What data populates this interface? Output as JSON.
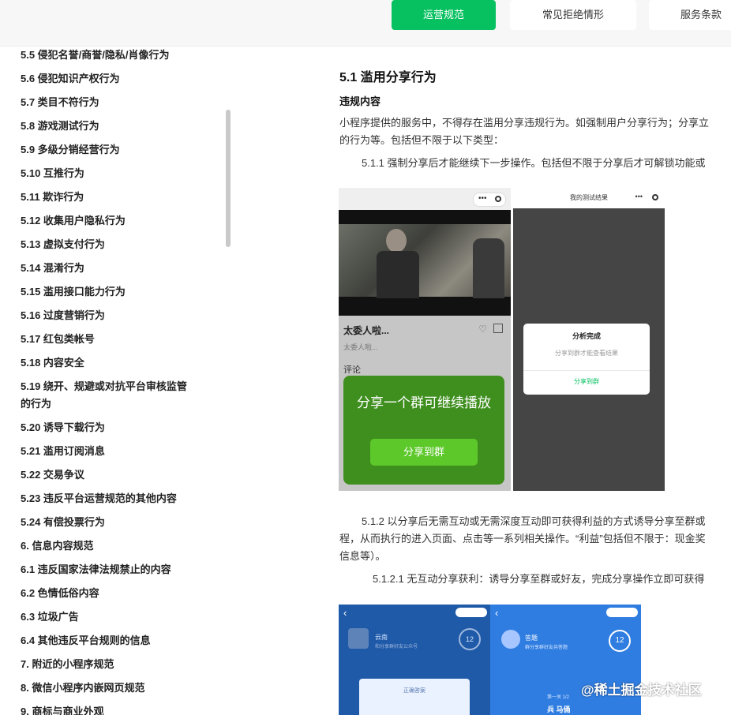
{
  "tabs": [
    {
      "label": "运营规范",
      "active": true
    },
    {
      "label": "常见拒绝情形",
      "active": false
    },
    {
      "label": "服务条款",
      "active": false
    }
  ],
  "sidebar": {
    "items": [
      "5.5 侵犯名誉/商誉/隐私/肖像行为",
      "5.6 侵犯知识产权行为",
      "5.7 类目不符行为",
      "5.8 游戏测试行为",
      "5.9 多级分销经营行为",
      "5.10 互推行为",
      "5.11 欺诈行为",
      "5.12 收集用户隐私行为",
      "5.13 虚拟支付行为",
      "5.14 混淆行为",
      "5.15 滥用接口能力行为",
      "5.16 过度营销行为",
      "5.17 红包类帐号",
      "5.18 内容安全",
      "5.19 绕开、规避或对抗平台审核监管的行为",
      "5.20 诱导下载行为",
      "5.21 滥用订阅消息",
      "5.22 交易争议",
      "5.23 违反平台运营规范的其他内容",
      "5.24 有偿投票行为",
      "6. 信息内容规范",
      "6.1 违反国家法律法规禁止的内容",
      "6.2 色情低俗内容",
      "6.3 垃圾广告",
      "6.4 其他违反平台规则的信息",
      "7. 附近的小程序规范",
      "8. 微信小程序内嵌网页规范",
      "9. 商标与商业外观"
    ]
  },
  "content": {
    "heading": "5.1 滥用分享行为",
    "subheading": "违规内容",
    "para1_line1": "小程序提供的服务中，不得存在滥用分享违规行为。如强制用户分享行为；分享立",
    "para1_line2": "的行为等。包括但不限于以下类型：",
    "para2": "5.1.1 强制分享后才能继续下一步操作。包括但不限于分享后才可解锁功能或",
    "para3_line1": "5.1.2 以分享后无需互动或无需深度互动即可获得利益的方式诱导分享至群或",
    "para3_line2": "程，从而执行的进入页面、点击等一系列相关操作。“利益”包括但不限于：现金奖",
    "para3_line3": "信息等）。",
    "para4": "5.1.2.1 无互动分享获利：诱导分享至群或好友，完成分享操作立即可获得"
  },
  "shot1": {
    "left_title": "太委人啦...",
    "left_sub": "太委人啦...",
    "comment": "评论",
    "overlay_text": "分享一个群可继续播放",
    "overlay_button": "分享到群",
    "right_header": "我的测试结果",
    "dialog_title": "分析完成",
    "dialog_sub": "分享到群才能查看结果",
    "dialog_button": "分享到群"
  },
  "shot2": {
    "left_name": "云南",
    "left_sub": "和分享群好友公众号",
    "left_badge": "12",
    "left_button": "正确答案",
    "right_name": "答题",
    "right_sub": "群分享群好友共答题",
    "right_badge": "12",
    "right_line1": "第一关  1/2",
    "right_line2": "兵  马俑"
  },
  "watermark": "@稀土掘金技术社区",
  "colors": {
    "accent": "#07c160",
    "overlay_green": "#3f8f1f",
    "button_green": "#5cc82a",
    "share_blue": "#2f7de1"
  }
}
